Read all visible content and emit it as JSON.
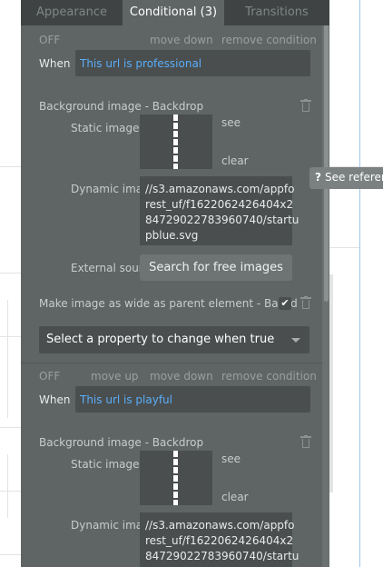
{
  "tabs": [
    {
      "label": "Appearance"
    },
    {
      "label": "Conditional (3)"
    },
    {
      "label": "Transitions"
    }
  ],
  "conditions": [
    {
      "status": "OFF",
      "move_up": "",
      "move_down": "move down",
      "remove": "remove condition",
      "when_label": "When",
      "when_value": "This url is professional",
      "bg_label": "Background image - Backdrop",
      "static_label": "Static image",
      "see": "see",
      "clear": "clear",
      "dynamic_label": "Dynamic imag",
      "dynamic_value": "//s3.amazonaws.com/appfo\nrest_uf/f1622062426404x2\n84729022783960740/startu\npblue.svg",
      "external_label": "External sourc",
      "search_button": "Search for free images",
      "wide_label": "Make image as wide as parent element - Backd",
      "select_placeholder": "Select a property to change when true"
    },
    {
      "status": "OFF",
      "move_up": "move up",
      "move_down": "move down",
      "remove": "remove condition",
      "when_label": "When",
      "when_value": "This url is playful",
      "bg_label": "Background image - Backdrop",
      "static_label": "Static image",
      "see": "see",
      "clear": "clear",
      "dynamic_label": "Dynamic imag",
      "dynamic_value": "//s3.amazonaws.com/appfo\nrest_uf/f1622062426404x2\n84729022783960740/startu"
    }
  ],
  "tooltip": {
    "icon": "?",
    "text": "See reference"
  },
  "checkbox_mark": "✔"
}
